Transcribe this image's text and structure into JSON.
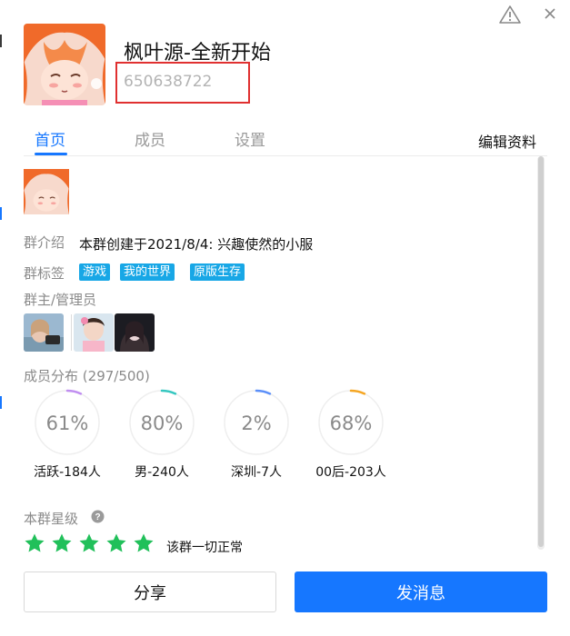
{
  "header": {
    "group_name": "枫叶源-全新开始",
    "group_id": "650638722"
  },
  "tabs": [
    {
      "label": "首页",
      "active": true
    },
    {
      "label": "成员",
      "active": false
    },
    {
      "label": "设置",
      "active": false
    }
  ],
  "edit_label": "编辑资料",
  "intro": {
    "label": "群介绍",
    "text": "本群创建于2021/8/4:  兴趣使然的小服"
  },
  "tags": {
    "label": "群标签",
    "items": [
      "游戏",
      "我的世界",
      "原版生存"
    ]
  },
  "admins": {
    "label": "群主/管理员"
  },
  "distribution": {
    "label": "成员分布",
    "count": "(297/500)",
    "stats": [
      {
        "percent": "61%",
        "fraction": 0.61,
        "caption": "活跃-184人",
        "color": "#c08ef0"
      },
      {
        "percent": "80%",
        "fraction": 0.8,
        "caption": "男-240人",
        "color": "#35c7c0"
      },
      {
        "percent": "2%",
        "fraction": 0.02,
        "caption": "深圳-7人",
        "color": "#5b8ff9"
      },
      {
        "percent": "68%",
        "fraction": 0.68,
        "caption": "00后-203人",
        "color": "#f5a623"
      }
    ]
  },
  "level": {
    "label": "本群星级",
    "stars": 5,
    "status": "该群一切正常"
  },
  "buttons": {
    "share": "分享",
    "send": "发消息"
  },
  "colors": {
    "accent": "#1677ff",
    "tag_bg": "#18a7e6",
    "star": "#21c05a",
    "highlight_box": "#e03030"
  }
}
